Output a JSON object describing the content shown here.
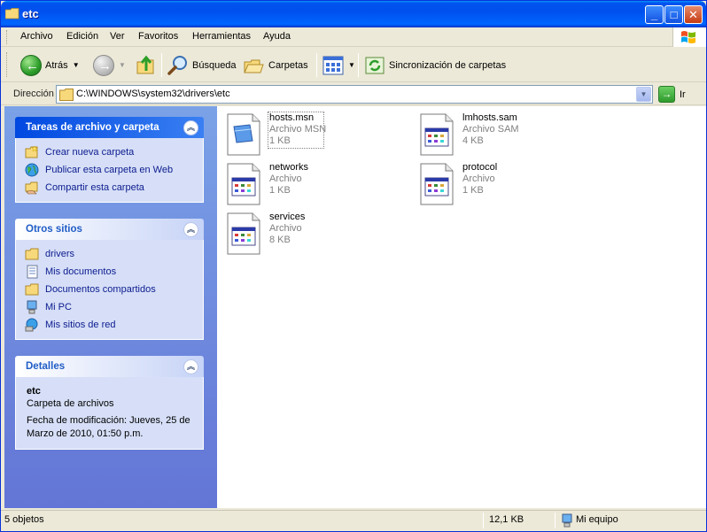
{
  "window": {
    "title": "etc"
  },
  "menu": [
    "Archivo",
    "Edición",
    "Ver",
    "Favoritos",
    "Herramientas",
    "Ayuda"
  ],
  "toolbar": {
    "back": "Atrás",
    "search": "Búsqueda",
    "folders": "Carpetas",
    "sync": "Sincronización de carpetas"
  },
  "address": {
    "label": "Dirección",
    "value": "C:\\WINDOWS\\system32\\drivers\\etc",
    "go": "Ir"
  },
  "tasks_panel": {
    "title": "Tareas de archivo y carpeta",
    "items": [
      "Crear nueva carpeta",
      "Publicar esta carpeta en Web",
      "Compartir esta carpeta"
    ]
  },
  "places_panel": {
    "title": "Otros sitios",
    "items": [
      "drivers",
      "Mis documentos",
      "Documentos compartidos",
      "Mi PC",
      "Mis sitios de red"
    ]
  },
  "details_panel": {
    "title": "Detalles",
    "name": "etc",
    "type": "Carpeta de archivos",
    "modified_line1": "Fecha de modificación: Jueves, 25 de",
    "modified_line2": "Marzo de 2010, 01:50 p.m."
  },
  "files": [
    {
      "name": "hosts.msn",
      "type": "Archivo MSN",
      "size": "1 KB"
    },
    {
      "name": "lmhosts.sam",
      "type": "Archivo SAM",
      "size": "4 KB"
    },
    {
      "name": "networks",
      "type": "Archivo",
      "size": "1 KB"
    },
    {
      "name": "protocol",
      "type": "Archivo",
      "size": "1 KB"
    },
    {
      "name": "services",
      "type": "Archivo",
      "size": "8 KB"
    }
  ],
  "status": {
    "count": "5 objetos",
    "size": "12,1 KB",
    "location": "Mi equipo"
  }
}
